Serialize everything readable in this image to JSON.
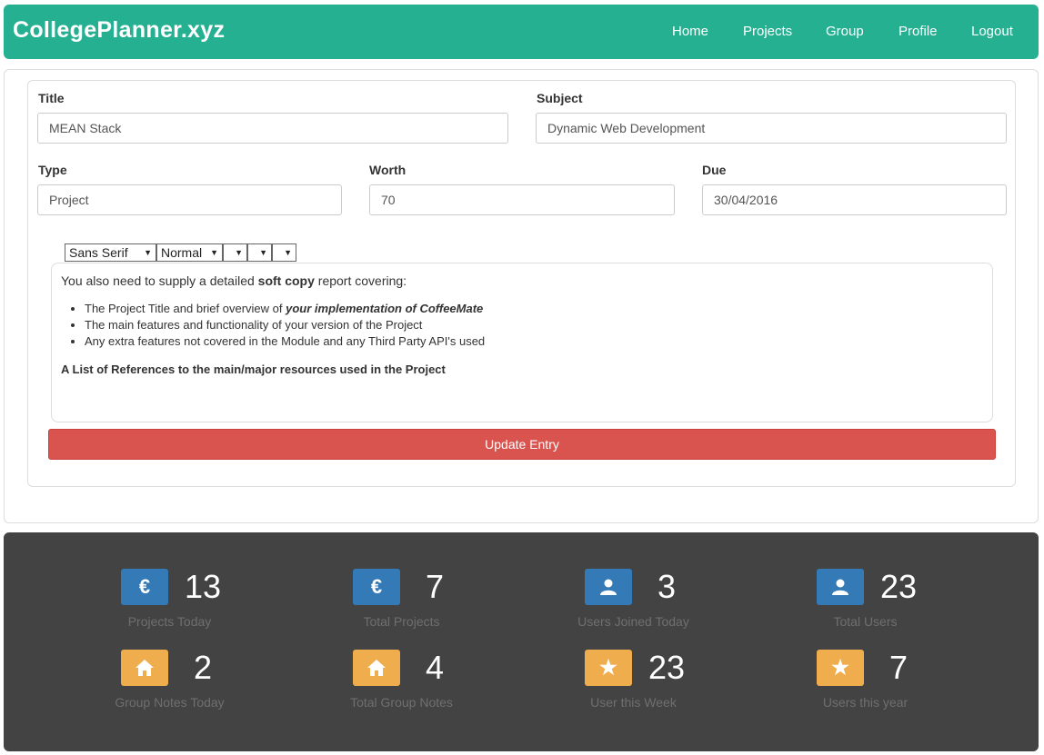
{
  "navbar": {
    "brand": "CollegePlanner.xyz",
    "links": [
      "Home",
      "Projects",
      "Group",
      "Profile",
      "Logout"
    ]
  },
  "form": {
    "title_label": "Title",
    "title_value": "MEAN Stack",
    "subject_label": "Subject",
    "subject_value": "Dynamic Web Development",
    "type_label": "Type",
    "type_value": "Project",
    "worth_label": "Worth",
    "worth_value": "70",
    "due_label": "Due",
    "due_value": "30/04/2016",
    "toolbar": {
      "font_value": "Sans Serif",
      "size_value": "Normal"
    },
    "editor": {
      "intro_before": "You also need to supply a detailed ",
      "intro_bold": "soft copy",
      "intro_after": " report covering:",
      "bullet1_before": "The Project Title and brief overview of ",
      "bullet1_em": "your implementation of CoffeeMate",
      "bullet2": "The main features and functionality of your version of the Project",
      "bullet3": "Any extra features not covered in the Module and any Third Party API's used",
      "references": "A List of References to the main/major resources used in the Project"
    },
    "submit_label": "Update Entry"
  },
  "stats": [
    {
      "icon": "euro-icon",
      "glyph": "€",
      "color": "#337ab7",
      "value": "13",
      "label": "Projects Today"
    },
    {
      "icon": "euro-icon",
      "glyph": "€",
      "color": "#337ab7",
      "value": "7",
      "label": "Total Projects"
    },
    {
      "icon": "user-icon",
      "glyph": "",
      "color": "#337ab7",
      "value": "3",
      "label": "Users Joined Today"
    },
    {
      "icon": "user-icon",
      "glyph": "",
      "color": "#337ab7",
      "value": "23",
      "label": "Total Users"
    },
    {
      "icon": "home-icon",
      "glyph": "",
      "color": "#f0ad4e",
      "value": "2",
      "label": "Group Notes Today"
    },
    {
      "icon": "home-icon",
      "glyph": "",
      "color": "#f0ad4e",
      "value": "4",
      "label": "Total Group Notes"
    },
    {
      "icon": "star-icon",
      "glyph": "★",
      "color": "#f0ad4e",
      "value": "23",
      "label": "User this Week"
    },
    {
      "icon": "star-icon",
      "glyph": "★",
      "color": "#f0ad4e",
      "value": "7",
      "label": "Users this year"
    }
  ]
}
